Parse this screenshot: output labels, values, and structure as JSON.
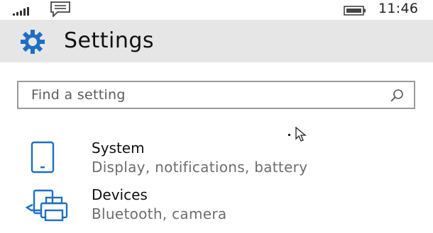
{
  "status_bar": {
    "time": "11:46",
    "icons": [
      "signal-icon",
      "message-icon",
      "battery-icon"
    ]
  },
  "header": {
    "title": "Settings",
    "icon": "gear-icon"
  },
  "search": {
    "placeholder": "Find a setting",
    "icon": "search-icon"
  },
  "categories": [
    {
      "title": "System",
      "description": "Display, notifications, battery",
      "icon": "phone-icon"
    },
    {
      "title": "Devices",
      "description": "Bluetooth, camera",
      "icon": "devices-icon"
    }
  ],
  "colors": {
    "accent": "#1e6fc4",
    "header_bg": "#e6e6e6",
    "secondary_text": "#6d6d6d"
  }
}
